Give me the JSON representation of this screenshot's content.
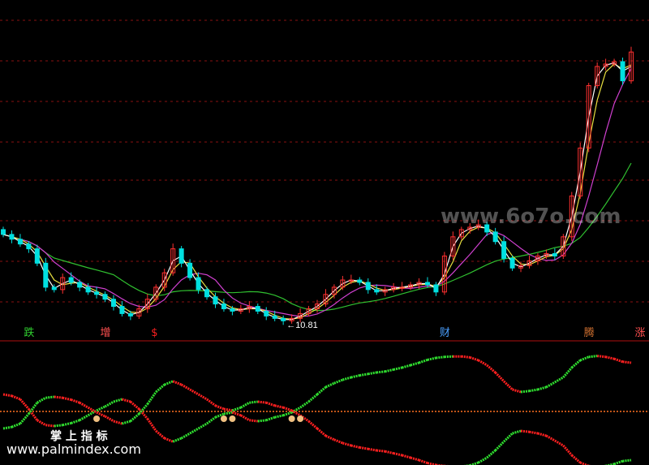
{
  "chart_data": {
    "type": "candlestick",
    "price_panel": {
      "low_annotation": "10.81",
      "ma_colors": {
        "ma5": "#ffffff",
        "ma10": "#e8e040",
        "ma20": "#d040d0",
        "ma60": "#30c030"
      },
      "up_color": "#ff3030",
      "down_color": "#00e0e0",
      "closes": [
        14.4,
        14.2,
        14.0,
        13.8,
        13.2,
        12.2,
        12.1,
        12.6,
        12.4,
        12.2,
        12.0,
        11.9,
        11.7,
        11.4,
        11.1,
        11.0,
        11.3,
        11.7,
        12.2,
        12.8,
        13.8,
        13.2,
        12.6,
        12.1,
        11.8,
        11.5,
        11.3,
        11.2,
        11.3,
        11.4,
        11.2,
        11.0,
        10.9,
        10.8,
        10.9,
        11.1,
        11.3,
        11.5,
        11.9,
        12.2,
        12.5,
        12.5,
        12.4,
        12.1,
        12.0,
        12.1,
        12.2,
        12.2,
        12.3,
        12.4,
        12.3,
        12.0,
        13.5,
        14.3,
        14.6,
        14.7,
        14.8,
        14.5,
        14.1,
        13.4,
        13.0,
        13.1,
        13.3,
        13.5,
        13.6,
        13.5,
        14.3,
        16.0,
        18.0,
        20.6,
        21.4,
        21.5,
        21.6,
        20.8,
        22.0
      ],
      "signals": [
        {
          "label": "跌",
          "color": "#30d030",
          "index": 3
        },
        {
          "label": "增",
          "color": "#ff5050",
          "index": 12
        },
        {
          "label": "$",
          "color": "#ff2020",
          "index": 18
        },
        {
          "label": "财",
          "color": "#4aa0ff",
          "index": 52
        },
        {
          "label": "腾",
          "color": "#d07030",
          "index": 69
        },
        {
          "label": "涨",
          "color": "#ff5050",
          "index": 75
        }
      ]
    },
    "oscillator": {
      "upper": [
        -0.35,
        -0.32,
        -0.25,
        -0.05,
        0.18,
        0.28,
        0.3,
        0.28,
        0.24,
        0.18,
        0.08,
        -0.02,
        -0.1,
        -0.2,
        -0.25,
        -0.2,
        -0.05,
        0.15,
        0.4,
        0.55,
        0.62,
        0.55,
        0.45,
        0.35,
        0.25,
        0.12,
        0.05,
        0.02,
        0.08,
        0.18,
        0.2,
        0.18,
        0.12,
        0.08,
        0.02,
        -0.08,
        -0.2,
        -0.35,
        -0.5,
        -0.58,
        -0.65,
        -0.7,
        -0.74,
        -0.77,
        -0.8,
        -0.82,
        -0.86,
        -0.9,
        -0.95,
        -1.0,
        -1.06,
        -1.1,
        -1.12,
        -1.13,
        -1.13,
        -1.11,
        -1.05,
        -0.95,
        -0.8,
        -0.62,
        -0.45,
        -0.4,
        -0.42,
        -0.45,
        -0.5,
        -0.6,
        -0.7,
        -0.9,
        -1.05,
        -1.12,
        -1.14,
        -1.12,
        -1.08,
        -1.02,
        -1.0
      ],
      "lower": [
        0.35,
        0.32,
        0.25,
        0.05,
        -0.18,
        -0.28,
        -0.3,
        -0.28,
        -0.24,
        -0.18,
        -0.08,
        0.02,
        0.1,
        0.2,
        0.25,
        0.2,
        0.05,
        -0.15,
        -0.4,
        -0.55,
        -0.62,
        -0.55,
        -0.45,
        -0.35,
        -0.25,
        -0.12,
        -0.05,
        -0.02,
        -0.08,
        -0.18,
        -0.2,
        -0.18,
        -0.12,
        -0.08,
        -0.02,
        0.08,
        0.2,
        0.35,
        0.5,
        0.58,
        0.65,
        0.7,
        0.74,
        0.77,
        0.8,
        0.82,
        0.86,
        0.9,
        0.95,
        1.0,
        1.06,
        1.1,
        1.12,
        1.13,
        1.13,
        1.11,
        1.05,
        0.95,
        0.8,
        0.62,
        0.45,
        0.4,
        0.42,
        0.45,
        0.5,
        0.6,
        0.7,
        0.9,
        1.05,
        1.12,
        1.14,
        1.12,
        1.08,
        1.02,
        1.0
      ],
      "color_up": "#30e030",
      "color_down": "#ff2020",
      "zero_line_color": "#ff7020"
    },
    "watermarks": {
      "site_mark": "www.6o7o.com",
      "brand_cn": "掌 上 指 标",
      "brand_url": "www.palmindex.com"
    }
  }
}
